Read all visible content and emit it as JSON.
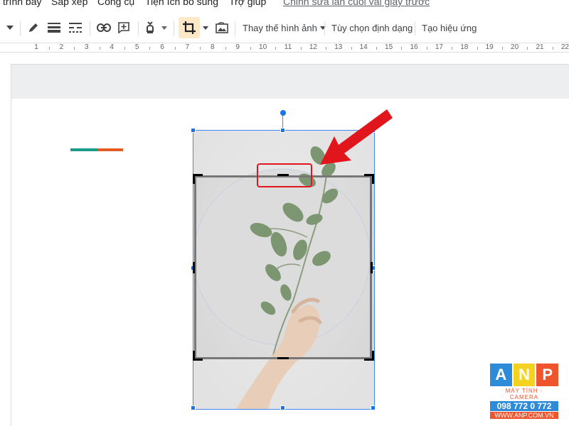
{
  "menu": {
    "items": [
      "trình bày",
      "Sắp xếp",
      "Công cụ",
      "Tiện ích bổ sung",
      "Trợ giúp"
    ],
    "last_edit": "Chỉnh sửa lần cuối vài giây trước"
  },
  "toolbar": {
    "replace_image_label": "Thay thế hình ảnh",
    "format_options_label": "Tùy chọn định dạng",
    "animate_label": "Tạo hiệu ứng",
    "icons": [
      "caret-down-icon",
      "pen-icon",
      "line-weight-icon",
      "line-dash-icon",
      "link-icon",
      "add-comment-icon",
      "highlight-icon",
      "crop-icon",
      "reset-image-icon"
    ]
  },
  "ruler": {
    "labels": [
      "1",
      "2",
      "3",
      "4",
      "5",
      "6",
      "7",
      "8",
      "9",
      "10",
      "11",
      "12",
      "13",
      "14",
      "15",
      "16",
      "17",
      "18",
      "19",
      "20",
      "21",
      "22"
    ]
  },
  "slide": {
    "accent_colors": [
      "#1a9a88",
      "#e35d23"
    ]
  },
  "annotation": {
    "color": "#e0161c"
  },
  "colors": {
    "selection": "#1a73e8",
    "crop_active_bg": "#fde8c8"
  },
  "watermark": {
    "letters": [
      "A",
      "N",
      "P"
    ],
    "letter_colors": [
      "#2e8bd9",
      "#f5d21f",
      "#f0542d"
    ],
    "tagline": "MÁY TÍNH - CAMERA",
    "phone": "098 772 0 772",
    "website": "WWW.ANP.COM.VN"
  }
}
